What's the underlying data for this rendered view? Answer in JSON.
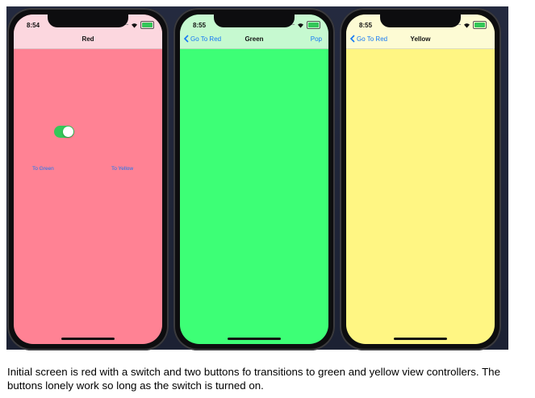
{
  "screens": [
    {
      "time": "8:54",
      "nav_title": "Red",
      "nav_back": "",
      "nav_right": "",
      "background": "#ff8294",
      "bar_color": "#fcd7df",
      "switch_on": true,
      "buttons": [
        "To Green",
        "To Yellow"
      ]
    },
    {
      "time": "8:55",
      "nav_title": "Green",
      "nav_back": "Go To Red",
      "nav_right": "Pop",
      "background": "#3dff76",
      "bar_color": "#c6f9d0"
    },
    {
      "time": "8:55",
      "nav_title": "Yellow",
      "nav_back": "Go To Red",
      "nav_right": "",
      "background": "#fff683",
      "bar_color": "#fdfbd4"
    }
  ],
  "caption": "Initial screen is red with a switch and two buttons fo transitions to green and yellow view controllers. The buttons lonely work so long as the switch is turned on.",
  "colors": {
    "ios_blue": "#1478f5",
    "switch_green": "#34c759",
    "backdrop": "#242a3f"
  }
}
